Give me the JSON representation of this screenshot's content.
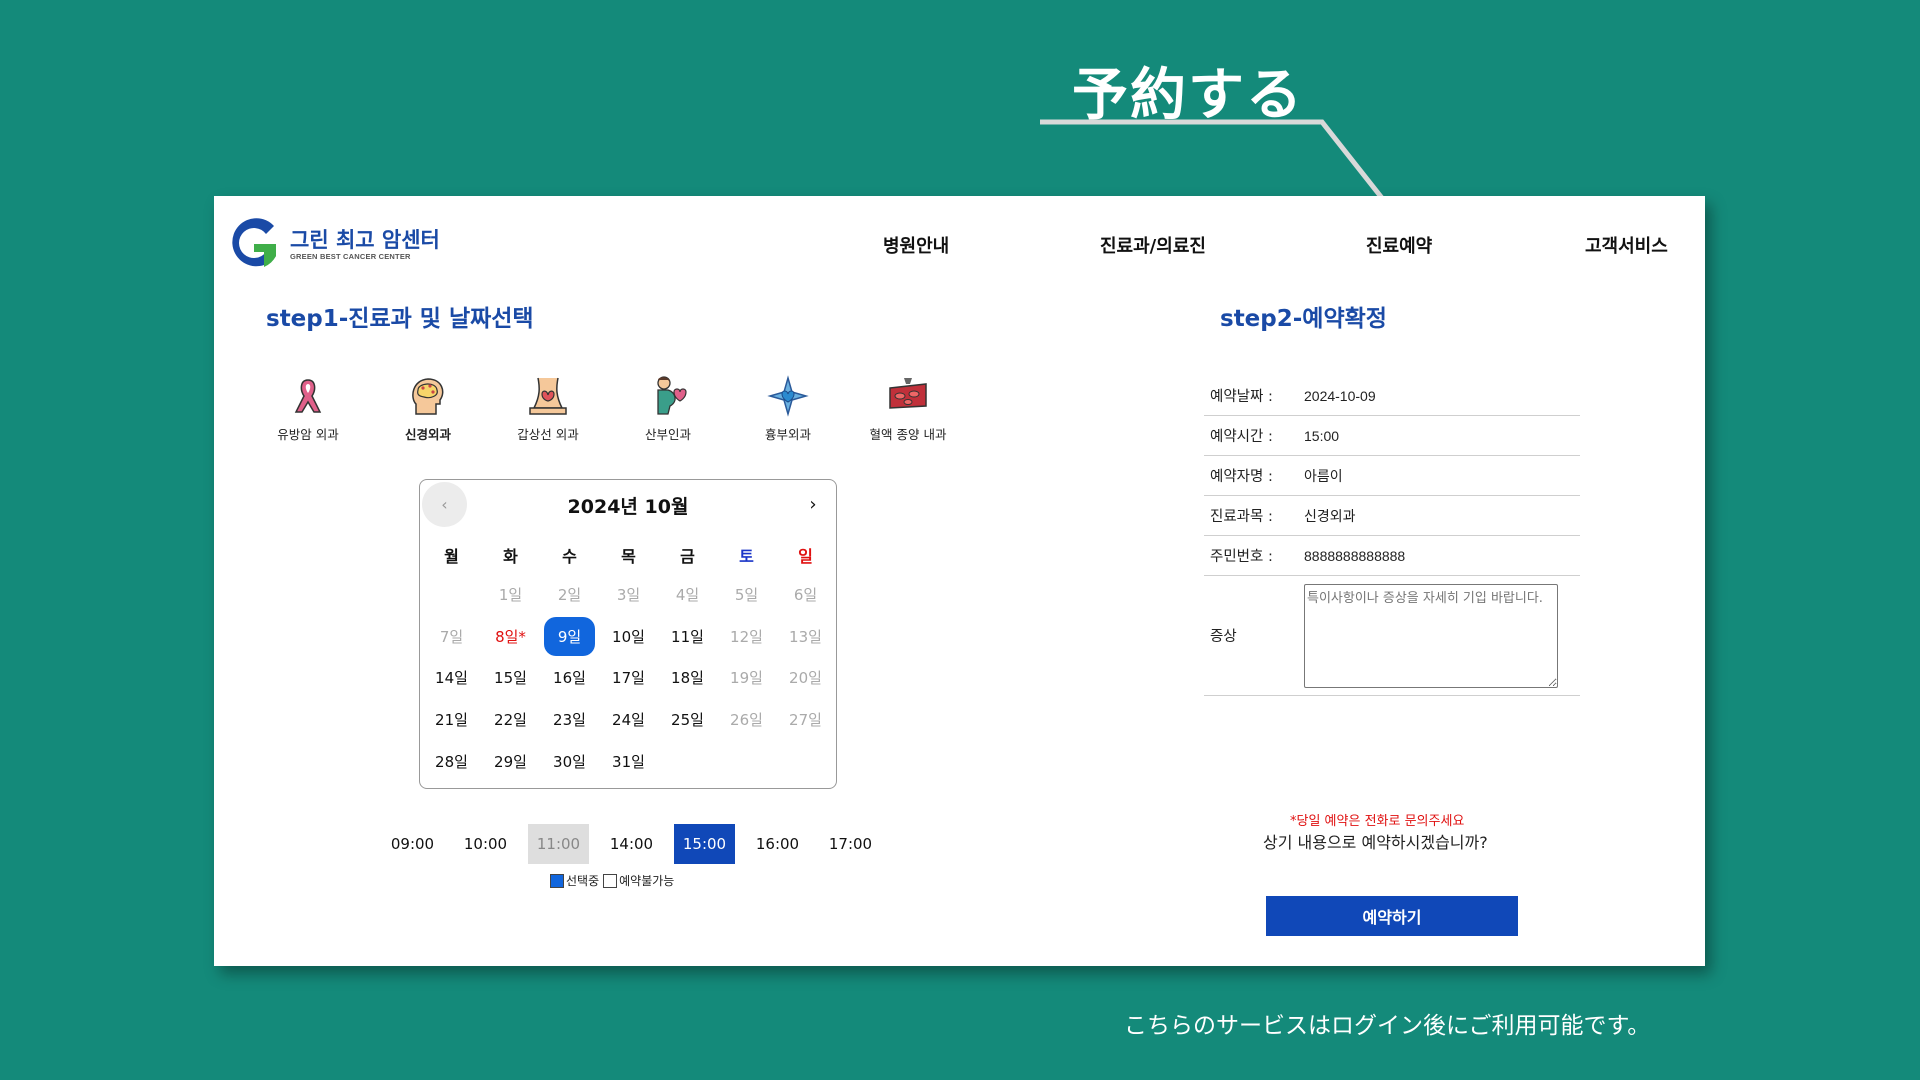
{
  "annotation": {
    "title": "予約する",
    "bottom_note": "こちらのサービスはログイン後にご利用可能です。"
  },
  "logo": {
    "main": "그린 최고 암센터",
    "sub": "GREEN BEST CANCER CENTER"
  },
  "nav": [
    "병원안내",
    "진료과/의료진",
    "진료예약",
    "고객서비스"
  ],
  "step1": {
    "title": "step1-진료과 및 날짜선택"
  },
  "step2": {
    "title": "step2-예약확정"
  },
  "departments": [
    {
      "label": "유방암 외과",
      "icon": "ribbon-icon"
    },
    {
      "label": "신경외과",
      "icon": "brain-icon",
      "active": true
    },
    {
      "label": "갑상선 외과",
      "icon": "thyroid-icon"
    },
    {
      "label": "산부인과",
      "icon": "pregnant-icon"
    },
    {
      "label": "흉부외과",
      "icon": "chest-icon"
    },
    {
      "label": "혈액 종양 내과",
      "icon": "blood-icon"
    }
  ],
  "calendar": {
    "title": "2024년 10월",
    "prev": "‹",
    "next": "›",
    "weekdays": [
      "월",
      "화",
      "수",
      "목",
      "금",
      "토",
      "일"
    ],
    "weeks": [
      [
        "",
        "1일",
        "2일",
        "3일",
        "4일",
        "5일",
        "6일"
      ],
      [
        "7일",
        "8일*",
        "9일",
        "10일",
        "11일",
        "12일",
        "13일"
      ],
      [
        "14일",
        "15일",
        "16일",
        "17일",
        "18일",
        "19일",
        "20일"
      ],
      [
        "21일",
        "22일",
        "23일",
        "24일",
        "25일",
        "26일",
        "27일"
      ],
      [
        "28일",
        "29일",
        "30일",
        "31일",
        "",
        "",
        ""
      ]
    ]
  },
  "times": [
    "09:00",
    "10:00",
    "11:00",
    "14:00",
    "15:00",
    "16:00",
    "17:00"
  ],
  "legend": {
    "selected": "선택중",
    "unavailable": "예약불가능"
  },
  "form": {
    "date_label": "예약날짜 :",
    "date_value": "2024-10-09",
    "time_label": "예약시간 :",
    "time_value": "15:00",
    "name_label": "예약자명 :",
    "name_value": "아름이",
    "dept_label": "진료과목 :",
    "dept_value": "신경외과",
    "id_label": "주민번호 :",
    "id_value": "8888888888888",
    "symptom_label": "증상",
    "symptom_placeholder": "특이사항이나 증상을 자세히 기입 바랍니다."
  },
  "notice": "*당일 예약은 전화로 문의주세요",
  "confirm": "상기 내용으로 예약하시겠습니까?",
  "reserve_button": "예약하기",
  "colors": {
    "background": "#148a7a",
    "brand_blue": "#1a4aa6",
    "selected_blue": "#1166dd",
    "button_blue": "#1048b8",
    "red": "#e01010"
  }
}
